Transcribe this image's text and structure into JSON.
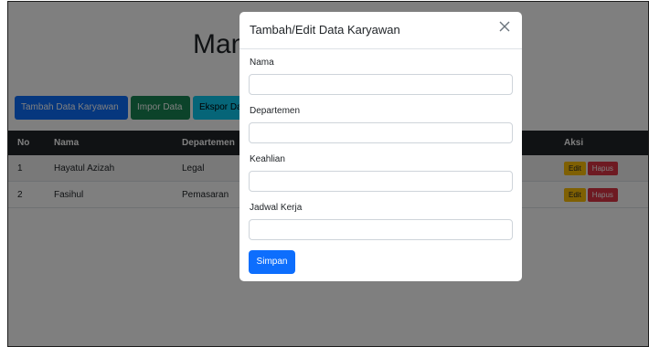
{
  "page": {
    "title": "Mana",
    "buttons": {
      "add": "Tambah Data Karyawan",
      "import": "Impor Data",
      "export": "Ekspor Da"
    }
  },
  "table": {
    "headers": [
      "No",
      "Nama",
      "Departemen",
      "Aksi"
    ],
    "rows": [
      {
        "no": "1",
        "nama": "Hayatul Azizah",
        "departemen": "Legal",
        "edit": "Edit",
        "hapus": "Hapus"
      },
      {
        "no": "2",
        "nama": "Fasihul",
        "departemen": "Pemasaran",
        "edit": "Edit",
        "hapus": "Hapus"
      }
    ]
  },
  "modal": {
    "title": "Tambah/Edit Data Karyawan",
    "close_icon": "close-icon",
    "fields": [
      {
        "label": "Nama",
        "value": ""
      },
      {
        "label": "Departemen",
        "value": ""
      },
      {
        "label": "Keahlian",
        "value": ""
      },
      {
        "label": "Jadwal Kerja",
        "value": ""
      }
    ],
    "submit_label": "Simpan"
  }
}
